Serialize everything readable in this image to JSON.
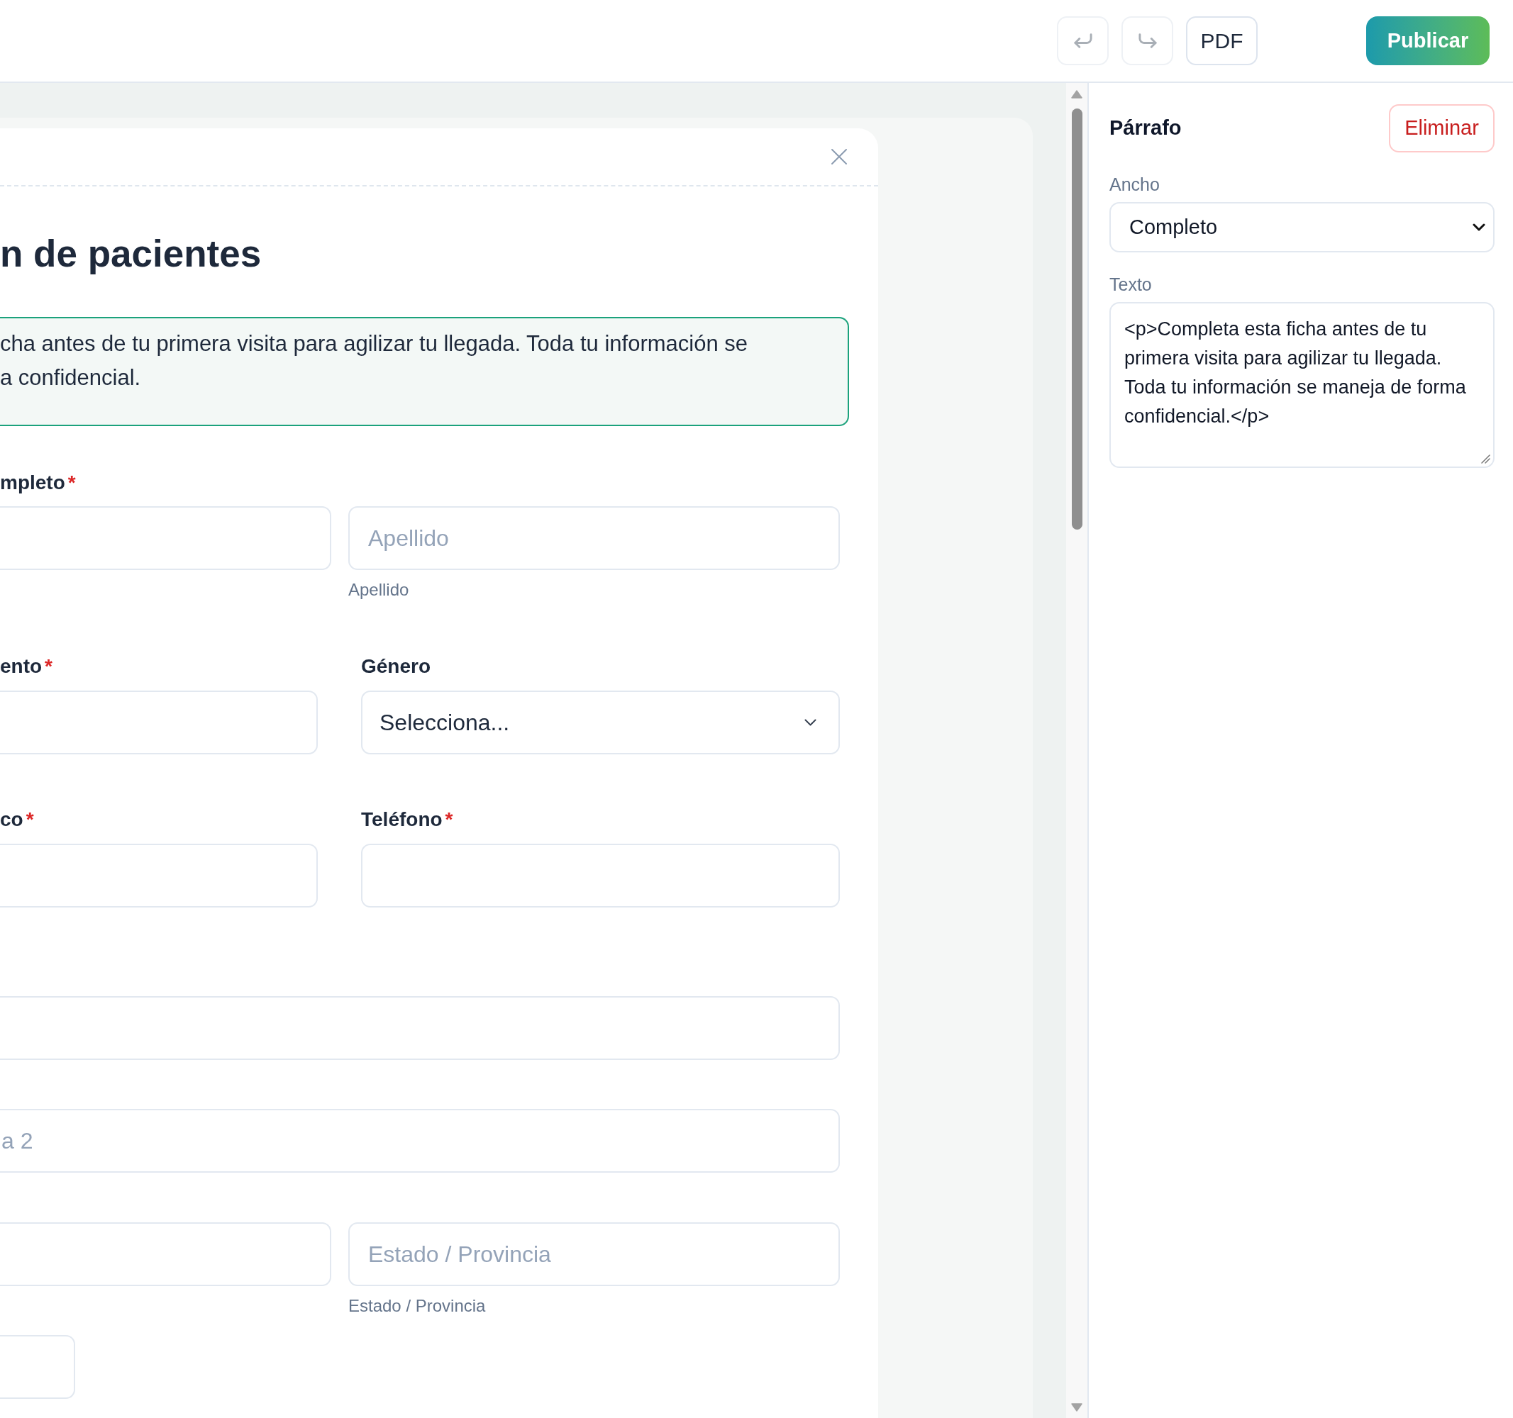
{
  "toolbar": {
    "buttons": [
      {
        "kind": "undo",
        "disabled": true
      },
      {
        "kind": "redo",
        "disabled": true
      },
      {
        "kind": "pdf",
        "label": "PDF",
        "disabled": false
      }
    ],
    "publish_label": "Publicar"
  },
  "canvas": {
    "blocks": [
      {
        "kind": "heading",
        "text": "n de pacientes",
        "selected": false
      },
      {
        "kind": "paragraph",
        "text": "cha antes de tu primera visita para agilizar tu llegada. Toda tu información se\na confidencial.",
        "selected": true
      },
      {
        "kind": "split",
        "label": "mpleto",
        "required_mark": "*",
        "selected": false,
        "fields": [
          {
            "kind": "input"
          },
          {
            "kind": "input",
            "placeholder": "Apellido",
            "helper": "Apellido"
          }
        ]
      },
      {
        "kind": "pair",
        "selected": false,
        "fields": [
          {
            "kind": "input",
            "label": "ento",
            "required_mark": "*"
          },
          {
            "kind": "select",
            "label": "Género",
            "value": "Selecciona..."
          }
        ]
      },
      {
        "kind": "pair",
        "selected": false,
        "fields": [
          {
            "kind": "input",
            "label": "co",
            "required_mark": "*"
          },
          {
            "kind": "input",
            "label": "Teléfono",
            "required_mark": "*"
          }
        ]
      },
      {
        "kind": "full",
        "selected": false,
        "fields": [
          {
            "kind": "input"
          }
        ]
      },
      {
        "kind": "full",
        "selected": false,
        "fields": [
          {
            "kind": "input",
            "placeholder": "a 2"
          }
        ]
      },
      {
        "kind": "split",
        "selected": false,
        "fields": [
          {
            "kind": "input"
          },
          {
            "kind": "input",
            "placeholder": "Estado / Provincia",
            "helper": "Estado / Provincia"
          }
        ]
      },
      {
        "kind": "short",
        "selected": false,
        "fields": [
          {
            "kind": "input"
          }
        ]
      }
    ]
  },
  "panel": {
    "title": "Párrafo",
    "delete_label": "Eliminar",
    "fields": [
      {
        "kind": "select",
        "label": "Ancho",
        "value": "Completo"
      },
      {
        "kind": "textarea",
        "label": "Texto",
        "value": "<p>Completa esta ficha antes de tu primera visita para agilizar tu llegada. Toda tu información se maneja de forma confidencial.</p>"
      }
    ]
  }
}
